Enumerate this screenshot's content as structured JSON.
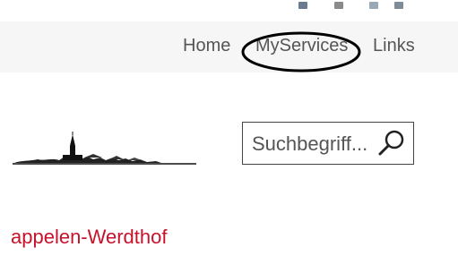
{
  "colors": {
    "nav_background": "#f6f6f6",
    "nav_text": "#555555",
    "heading_red": "#c8112b",
    "annotation": "#000000"
  },
  "nav": {
    "items": [
      {
        "label": "Home"
      },
      {
        "label": "MyServices"
      },
      {
        "label": "Links"
      }
    ],
    "highlighted_item": "MyServices"
  },
  "search": {
    "placeholder": "Suchbegriff...",
    "icon": "search-icon"
  },
  "page": {
    "heading": "appelen-Werdthof"
  },
  "logo": {
    "icon": "village-skyline-illustration"
  }
}
